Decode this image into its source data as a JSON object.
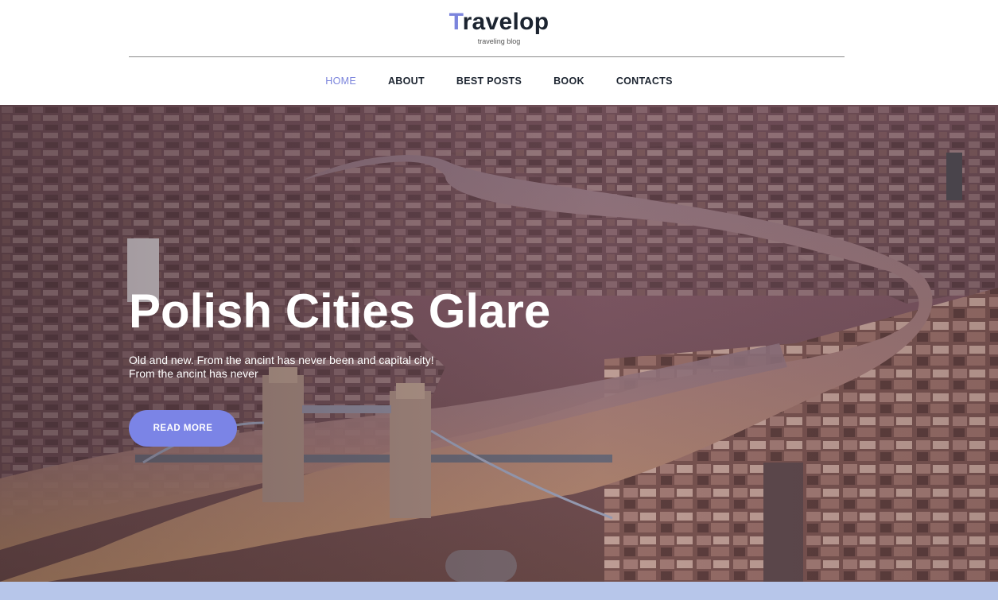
{
  "logo": {
    "first_letter": "T",
    "rest": "ravelop",
    "tagline": "traveling blog"
  },
  "nav": {
    "items": [
      {
        "label": "HOME",
        "active": true
      },
      {
        "label": "ABOUT",
        "active": false
      },
      {
        "label": "BEST POSTS",
        "active": false
      },
      {
        "label": "BOOK",
        "active": false
      },
      {
        "label": "CONTACTS",
        "active": false
      }
    ]
  },
  "hero": {
    "title": "Polish Cities Glare",
    "subtitle_line1": "Old and new. From the ancint has never been and capital city!",
    "subtitle_line2": "From the ancint has never",
    "button_label": "READ MORE",
    "image": "aerial-city-river-bridge-photo"
  },
  "colors": {
    "accent": "#7b84dc",
    "button": "#7b84e6",
    "text_dark": "#1c2430",
    "footer_strip": "#b7c6ea"
  }
}
